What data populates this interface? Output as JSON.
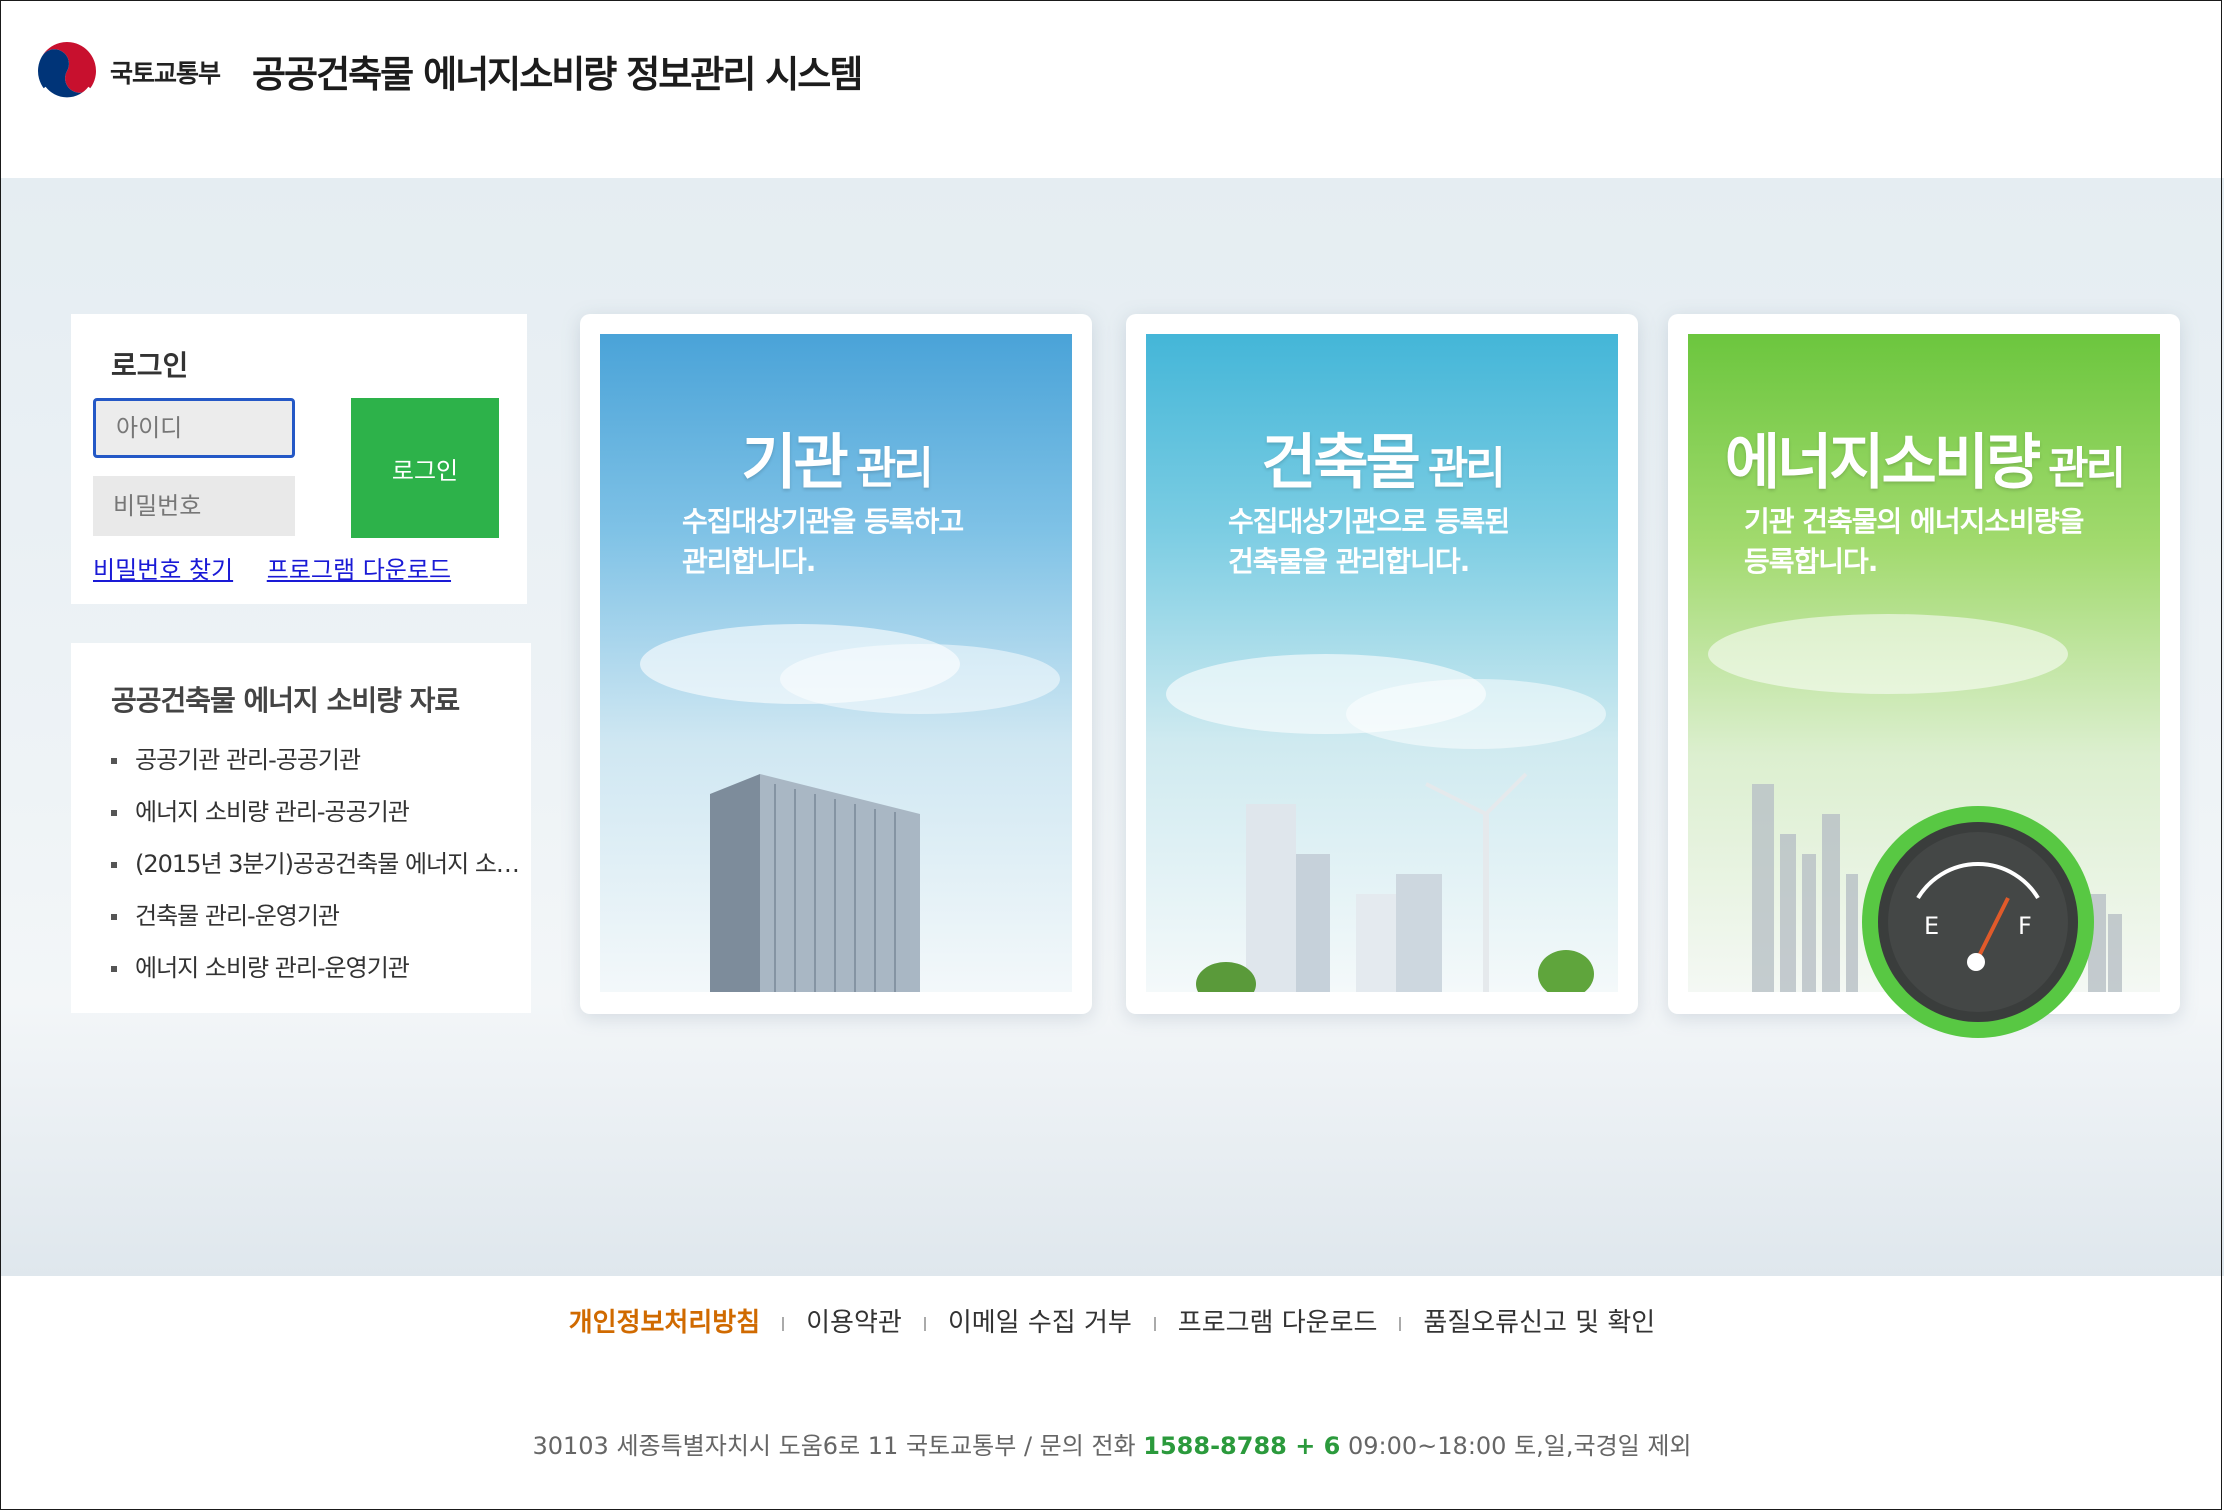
{
  "header": {
    "ministry": "국토교통부",
    "system_title": "공공건축물 에너지소비량 정보관리 시스템"
  },
  "login": {
    "title": "로그인",
    "id_placeholder": "아이디",
    "pw_placeholder": "비밀번호",
    "button": "로그인",
    "find_password": "비밀번호 찾기",
    "program_download": "프로그램 다운로드"
  },
  "resources": {
    "title": "공공건축물 에너지 소비량 자료",
    "items": [
      "공공기관 관리-공공기관",
      "에너지 소비량 관리-공공기관",
      "(2015년 3분기)공공건축물 에너지 소…",
      "건축물 관리-운영기관",
      "에너지 소비량 관리-운영기관"
    ]
  },
  "cards": [
    {
      "title_main": "기관",
      "title_sub": "관리",
      "desc": [
        "수집대상기관을 등록하고",
        "관리합니다."
      ]
    },
    {
      "title_main": "건축물",
      "title_sub": "관리",
      "desc": [
        "수집대상기관으로 등록된",
        "건축물을 관리합니다."
      ]
    },
    {
      "title_main": "에너지소비량",
      "title_sub": "관리",
      "desc": [
        "기관 건축물의 에너지소비량을",
        "등록합니다."
      ]
    }
  ],
  "gauge": {
    "empty_label": "E",
    "full_label": "F"
  },
  "footer": {
    "links": [
      "개인정보처리방침",
      "이용약관",
      "이메일 수집 거부",
      "프로그램 다운로드",
      "품질오류신고 및 확인"
    ],
    "address": "30103 세종특별자치시 도움6로 11 국토교통부 / 문의 전화",
    "phone": "1588-8788 + 6",
    "hours": "09:00~18:00 토,일,국경일 제외"
  },
  "colors": {
    "login_button": "#2db24a",
    "link": "#1a1ad6",
    "privacy_link": "#d06a00",
    "phone": "#2b9a3c",
    "input_focus": "#2458c6"
  }
}
